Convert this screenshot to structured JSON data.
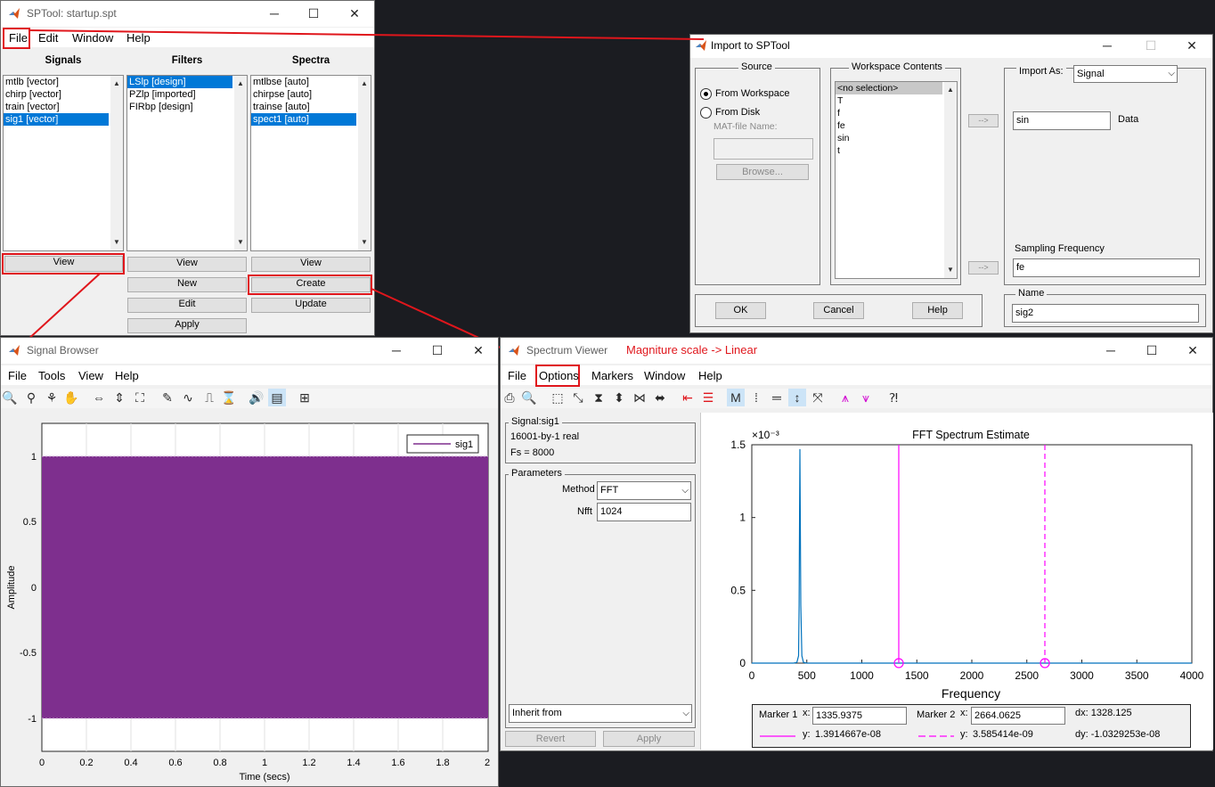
{
  "sptool": {
    "title": "SPTool: startup.spt",
    "menu": [
      "File",
      "Edit",
      "Window",
      "Help"
    ],
    "columns": {
      "signals": {
        "header": "Signals",
        "items": [
          "mtlb [vector]",
          "chirp [vector]",
          "train [vector]",
          "sig1 [vector]"
        ],
        "selected": 3
      },
      "filters": {
        "header": "Filters",
        "items": [
          "LSlp [design]",
          "PZlp [imported]",
          "FIRbp [design]"
        ],
        "selected": 0
      },
      "spectra": {
        "header": "Spectra",
        "items": [
          "mtlbse [auto]",
          "chirpse [auto]",
          "trainse [auto]",
          "spect1 [auto]"
        ],
        "selected": 3
      }
    },
    "buttons": {
      "signals_view": "View",
      "filters_view": "View",
      "filters_new": "New",
      "filters_edit": "Edit",
      "filters_apply": "Apply",
      "spectra_view": "View",
      "spectra_create": "Create",
      "spectra_update": "Update"
    }
  },
  "import": {
    "title": "Import to SPTool",
    "source_label": "Source",
    "from_workspace": "From Workspace",
    "from_disk": "From Disk",
    "matfile_label": "MAT-file Name:",
    "browse": "Browse...",
    "workspace_label": "Workspace Contents",
    "workspace_items": [
      "<no selection>",
      "T",
      "f",
      "fe",
      "sin",
      "t"
    ],
    "arrow": "-->",
    "import_as_label": "Import As:",
    "import_as_value": "Signal",
    "data_value": "sin",
    "data_label": "Data",
    "fs_label": "Sampling Frequency",
    "fs_value": "fe",
    "name_label": "Name",
    "name_value": "sig2",
    "ok": "OK",
    "cancel": "Cancel",
    "help": "Help"
  },
  "signal_browser": {
    "title": "Signal Browser",
    "menu": [
      "File",
      "Tools",
      "View",
      "Help"
    ],
    "legend": "sig1",
    "ylabel": "Amplitude",
    "xlabel": "Time (secs)",
    "yticks": [
      "1",
      "0.5",
      "0",
      "-0.5",
      "-1"
    ],
    "xticks": [
      "0",
      "0.2",
      "0.4",
      "0.6",
      "0.8",
      "1",
      "1.2",
      "1.4",
      "1.6",
      "1.8",
      "2"
    ],
    "signal_color": "#7e2f8e"
  },
  "spectrum_viewer": {
    "title": "Spectrum Viewer",
    "annotation": "Magniture scale -> Linear",
    "menu": [
      "File",
      "Options",
      "Markers",
      "Window",
      "Help"
    ],
    "signal_group": "Signal:sig1",
    "signal_info1": "16001-by-1 real",
    "signal_info2": "Fs = 8000",
    "params_group": "Parameters",
    "method_label": "Method",
    "method_value": "FFT",
    "nfft_label": "Nfft",
    "nfft_value": "1024",
    "inherit": "Inherit from",
    "revert": "Revert",
    "apply": "Apply",
    "plot_title": "FFT Spectrum Estimate",
    "exponent": "×10⁻³",
    "xlabel": "Frequency",
    "marker1_label": "Marker 1",
    "marker1_x": "1335.9375",
    "marker1_y": "1.3914667e-08",
    "marker2_label": "Marker 2",
    "marker2_x": "2664.0625",
    "marker2_y": "3.585414e-09",
    "x_label": "x:",
    "y_label": "y:",
    "dx": "dx:  1328.125",
    "dy": "dy:  -1.0329253e-08",
    "marker_color": "#ff00ff",
    "line_color": "#0072bd"
  },
  "chart_data": {
    "type": "line",
    "title": "FFT Spectrum Estimate",
    "xlabel": "Frequency",
    "ylabel": "",
    "xlim": [
      0,
      4000
    ],
    "ylim": [
      0,
      1.5
    ],
    "y_scale_note": "×10⁻³",
    "xticks": [
      0,
      500,
      1000,
      1500,
      2000,
      2500,
      3000,
      3500,
      4000
    ],
    "yticks": [
      0,
      0.5,
      1,
      1.5
    ],
    "x": [
      0,
      380,
      410,
      425,
      430,
      437,
      445,
      455,
      470,
      500,
      1000,
      1336,
      2000,
      2664,
      3000,
      4000
    ],
    "y": [
      0,
      0,
      0.005,
      0.05,
      0.4,
      1.47,
      0.4,
      0.05,
      0.005,
      0,
      0,
      0,
      0,
      0,
      0,
      0
    ],
    "markers": [
      1335.9375,
      2664.0625
    ]
  }
}
